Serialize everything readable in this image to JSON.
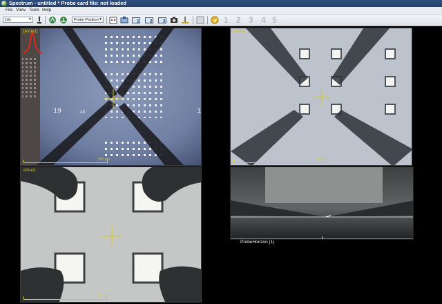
{
  "window": {
    "title": "Spectrum - untitled * Probe card file: not loaded"
  },
  "menu": [
    "File",
    "View",
    "Tools",
    "Help"
  ],
  "toolbar": {
    "zoom_value": "10x",
    "mode_value": "Probe Position",
    "buttons": [
      "microscope-tool",
      "probe-a",
      "probe-b",
      "probe-card",
      "scan-tool",
      "probe-1",
      "probe-2",
      "probe-3",
      "camera-tool",
      "light-tool",
      "blank-slot",
      "gold-probe"
    ],
    "probe_numbers": [
      "1",
      "2",
      "3",
      "4",
      "5"
    ]
  },
  "views": {
    "view1": {
      "label": "[eVue1]",
      "chip_text_left": "19",
      "chip_text_mid": "40",
      "chip_text_right": "1",
      "scale": "200 µm"
    },
    "view2": {
      "label": "eVue2",
      "scale": "50 µm"
    },
    "view3": {
      "label": "eVue3",
      "scale": "50 µm"
    },
    "view4": {
      "label": "ProbeHorizon (1)"
    }
  },
  "colors": {
    "accent": "#d8c81a",
    "title_bar": "#2f4f7f",
    "profile_marker": "#e02a1a"
  }
}
